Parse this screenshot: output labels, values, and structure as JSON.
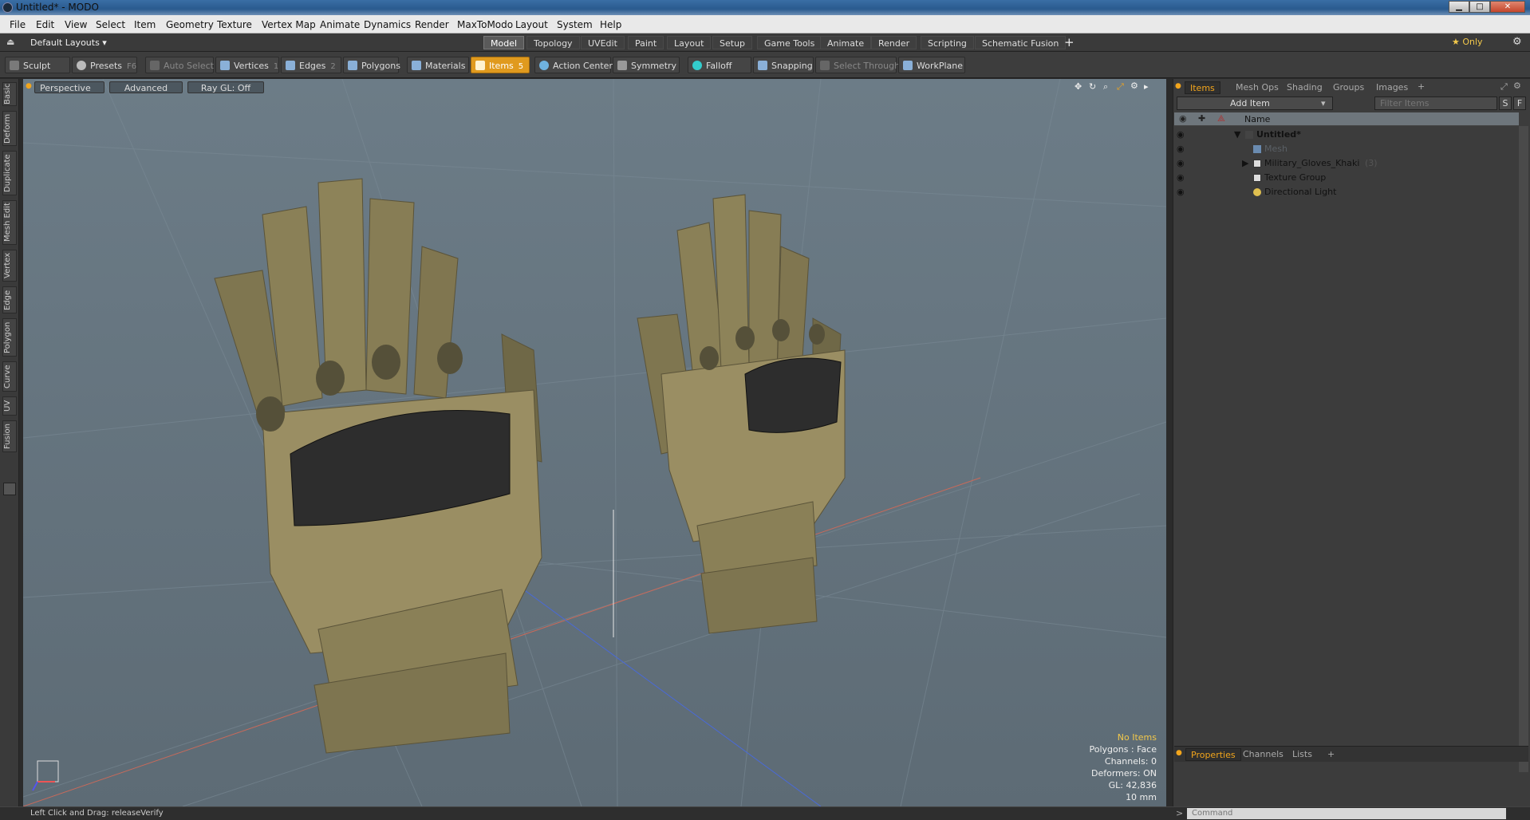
{
  "window": {
    "title": "Untitled* - MODO",
    "minimize": "▁",
    "maximize": "□",
    "close": "✕"
  },
  "menu": [
    "File",
    "Edit",
    "View",
    "Select",
    "Item",
    "Geometry",
    "Texture",
    "Vertex Map",
    "Animate",
    "Dynamics",
    "Render",
    "MaxToModo",
    "Layout",
    "System",
    "Help"
  ],
  "layout_bar": {
    "default_layouts": "Default Layouts ▾",
    "tabs": [
      "Model",
      "Topology",
      "UVEdit",
      "Paint",
      "Layout",
      "Setup",
      "Game Tools",
      "Animate",
      "Render",
      "Scripting",
      "Schematic Fusion"
    ],
    "active_tab": "Model",
    "add": "+",
    "only": "★  Only"
  },
  "toolbar": {
    "sculpt": "Sculpt",
    "presets": "Presets",
    "presets_key": "F6",
    "auto_select": "Auto Select",
    "vertices": "Vertices",
    "vertices_key": "1",
    "edges": "Edges",
    "edges_key": "2",
    "polygons": "Polygons",
    "materials": "Materials",
    "items": "Items",
    "items_key": "5",
    "action_center": "Action Center",
    "symmetry": "Symmetry",
    "falloff": "Falloff",
    "snapping": "Snapping",
    "select_through": "Select Through",
    "workplane": "WorkPlane"
  },
  "left_tabs": [
    "Basic",
    "Deform",
    "Duplicate",
    "Mesh Edit",
    "Vertex",
    "Edge",
    "Polygon",
    "Curve",
    "UV",
    "Fusion"
  ],
  "viewport": {
    "perspective": "Perspective",
    "advanced": "Advanced",
    "raygl": "Ray GL: Off",
    "info": {
      "no_items": "No Items",
      "polygons": "Polygons : Face",
      "channels": "Channels: 0",
      "deformers": "Deformers: ON",
      "gl": "GL: 42,836",
      "scale": "10 mm"
    }
  },
  "right_panel": {
    "tabs": [
      "Items",
      "Mesh Ops",
      "Shading",
      "Groups",
      "Images"
    ],
    "active_tab": "Items",
    "add_item": "Add Item",
    "filter_placeholder": "Filter Items",
    "s": "S",
    "f": "F",
    "col_name": "Name",
    "items": [
      {
        "name": "Untitled*",
        "indent": 0,
        "expand": "▼",
        "icon": "scene-icon",
        "bold": true
      },
      {
        "name": "Mesh",
        "indent": 1,
        "expand": "",
        "icon": "mesh-icon",
        "dim": true
      },
      {
        "name": "Military_Gloves_Khaki",
        "count": "(3)",
        "indent": 1,
        "expand": "▶",
        "icon": "locator-icon"
      },
      {
        "name": "Texture Group",
        "indent": 1,
        "expand": "",
        "icon": "locator-icon"
      },
      {
        "name": "Directional Light",
        "indent": 1,
        "expand": "",
        "icon": "light-icon"
      }
    ],
    "bottom_tabs": [
      "Properties",
      "Channels",
      "Lists"
    ],
    "bottom_active": "Properties"
  },
  "statusbar": {
    "text": "Left Click and Drag:  releaseVerify",
    "command_prompt": ">",
    "command_placeholder": "Command"
  },
  "colors": {
    "accent": "#f2a51c",
    "items_on": "#e09a1e"
  }
}
